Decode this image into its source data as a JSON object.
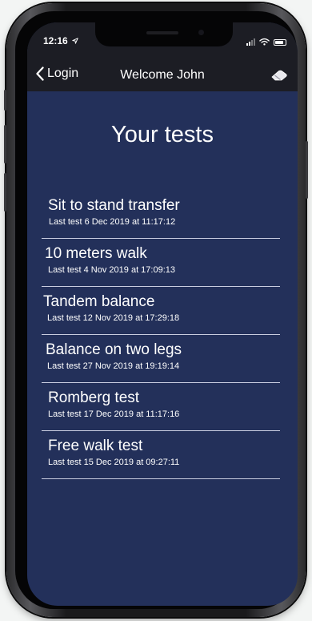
{
  "status_bar": {
    "time": "12:16"
  },
  "nav": {
    "back_label": "Login",
    "title": "Welcome John"
  },
  "page": {
    "title": "Your tests"
  },
  "tests": [
    {
      "name": "Sit to stand transfer",
      "last": "Last test 6 Dec 2019 at 11:17:12"
    },
    {
      "name": "10 meters walk",
      "last": "Last test 4 Nov 2019 at 17:09:13"
    },
    {
      "name": "Tandem balance",
      "last": "Last test 12 Nov 2019 at 17:29:18"
    },
    {
      "name": "Balance on two legs",
      "last": "Last test 27 Nov 2019 at 19:19:14"
    },
    {
      "name": "Romberg test",
      "last": "Last test 17 Dec 2019 at 11:17:16"
    },
    {
      "name": "Free walk test",
      "last": "Last test 15 Dec 2019 at 09:27:11"
    }
  ],
  "icons": {
    "back": "chevron-left-icon",
    "eraser": "eraser-icon",
    "location": "location-arrow-icon",
    "signal": "cellular-signal-icon",
    "wifi": "wifi-icon",
    "battery": "battery-icon"
  },
  "colors": {
    "screen_background": "#23305a",
    "bar_background": "#1c1d24",
    "text": "#ffffff",
    "separator": "#c9cde0"
  }
}
